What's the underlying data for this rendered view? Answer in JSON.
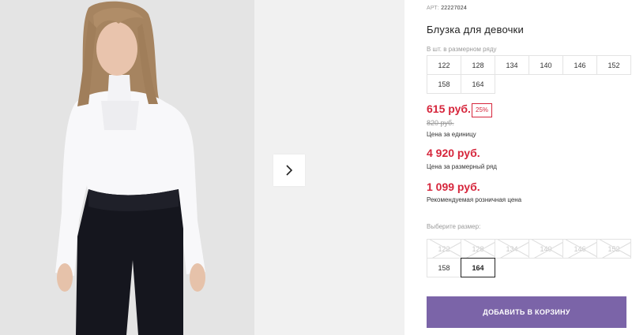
{
  "gallery": {
    "next_icon": "chevron-right-icon"
  },
  "product": {
    "article_label": "АРТ:",
    "article_number": "22227024",
    "title": "Блузка для девочки",
    "sizes_in_row_label": "В шт. в размерном ряду",
    "sizes_in_row": [
      "122",
      "128",
      "134",
      "140",
      "146",
      "152",
      "158",
      "164"
    ],
    "price_unit": "615 руб.",
    "discount": "25%",
    "price_old": "820 руб.",
    "price_unit_note": "Цена за единицу",
    "price_row": "4 920 руб.",
    "price_row_note": "Цена за размерный ряд",
    "price_rrp": "1 099 руб.",
    "price_rrp_note": "Рекомендуемая розничная цена",
    "choose_size_label": "Выберите размер:",
    "choose_sizes": [
      {
        "label": "122",
        "available": false
      },
      {
        "label": "128",
        "available": false
      },
      {
        "label": "134",
        "available": false
      },
      {
        "label": "140",
        "available": false
      },
      {
        "label": "146",
        "available": false
      },
      {
        "label": "152",
        "available": false
      },
      {
        "label": "158",
        "available": true
      },
      {
        "label": "164",
        "available": true
      }
    ],
    "selected_size": "164",
    "add_to_cart_label": "ДОБАВИТЬ В КОРЗИНУ"
  },
  "colors": {
    "price_red": "#d6263c",
    "cart_button": "#7b64a8"
  }
}
